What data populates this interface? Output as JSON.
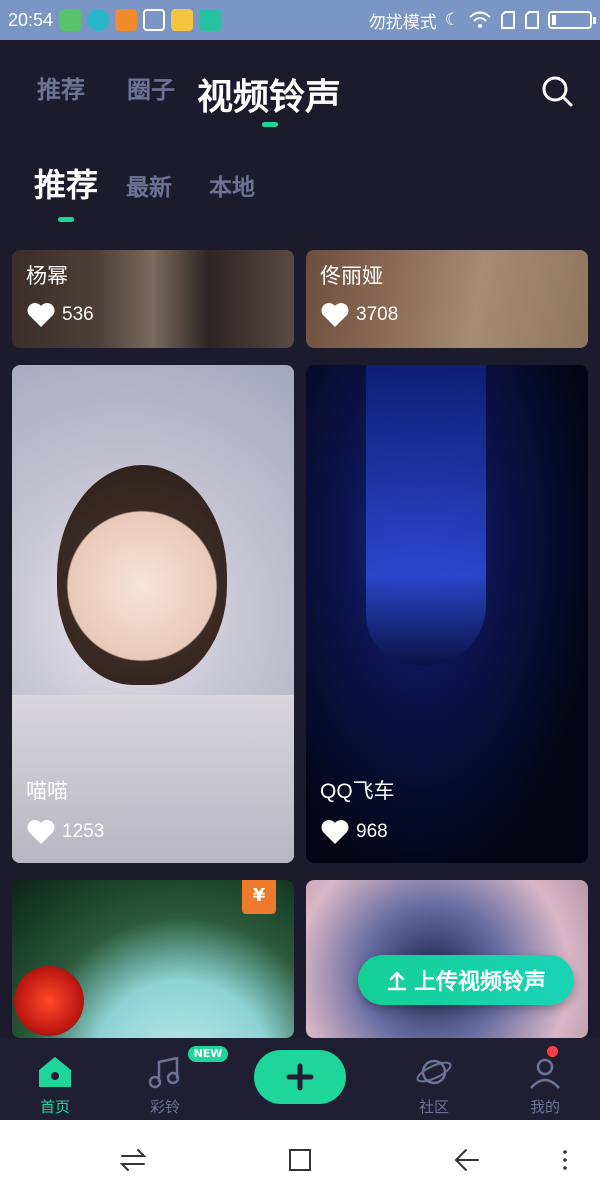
{
  "status_bar": {
    "time": "20:54",
    "dnd_text": "勿扰模式",
    "colors": {
      "bg": "#7b95c4"
    }
  },
  "top_tabs": {
    "items": [
      {
        "label": "推荐"
      },
      {
        "label": "圈子"
      },
      {
        "label": "视频铃声",
        "active": true
      }
    ]
  },
  "sub_tabs": {
    "items": [
      {
        "label": "推荐",
        "active": true
      },
      {
        "label": "最新"
      },
      {
        "label": "本地"
      }
    ]
  },
  "cards": [
    {
      "name": "杨幂",
      "likes": "536"
    },
    {
      "name": "佟丽娅",
      "likes": "3708"
    },
    {
      "name": "喵喵",
      "likes": "1253"
    },
    {
      "name": "QQ飞车",
      "likes": "968"
    },
    {
      "badge": "¥"
    },
    {}
  ],
  "upload_button": {
    "label": "上传视频铃声"
  },
  "bottom_nav": {
    "items": [
      {
        "label": "首页",
        "icon": "home-icon",
        "active": true
      },
      {
        "label": "彩铃",
        "icon": "music-icon",
        "badge": "NEW"
      },
      {
        "icon": "plus-icon"
      },
      {
        "label": "社区",
        "icon": "planet-icon"
      },
      {
        "label": "我的",
        "icon": "profile-icon"
      }
    ]
  },
  "colors": {
    "background": "#1c1b2e",
    "accent": "#1ed69a",
    "muted_text": "#6d7395"
  }
}
